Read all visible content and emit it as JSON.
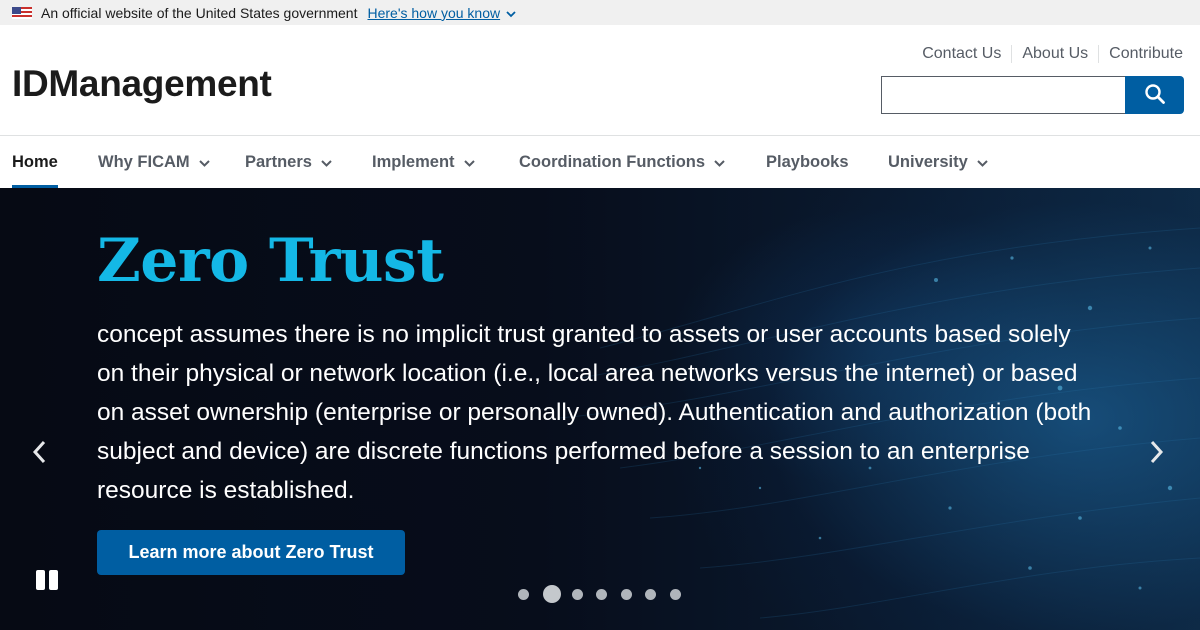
{
  "gov_banner": {
    "text": "An official website of the United States government",
    "link": "Here's how you know"
  },
  "header": {
    "site_title": "IDManagement",
    "secondary_links": [
      "Contact Us",
      "About Us",
      "Contribute"
    ],
    "search": {
      "value": "",
      "placeholder": ""
    }
  },
  "nav": {
    "items": [
      {
        "label": "Home",
        "active": true,
        "has_dropdown": false
      },
      {
        "label": "Why FICAM",
        "has_dropdown": true
      },
      {
        "label": "Partners",
        "has_dropdown": true
      },
      {
        "label": "Implement",
        "has_dropdown": true
      },
      {
        "label": "Coordination Functions",
        "has_dropdown": true
      },
      {
        "label": "Playbooks",
        "has_dropdown": false
      },
      {
        "label": "University",
        "has_dropdown": true
      }
    ]
  },
  "hero": {
    "title": "Zero Trust",
    "description": "concept assumes there is no implicit trust granted to assets or user accounts based solely on their physical or network location (i.e., local area networks versus the internet) or based on asset ownership (enterprise or personally owned). Authentication and authorization (both subject and device) are discrete functions performed before a session to an enterprise resource is established.",
    "cta_label": "Learn more about Zero Trust",
    "slide_count": 7,
    "active_slide": 2
  },
  "icons": {
    "flag": "us-flag-icon",
    "search": "search-icon",
    "dropdown": "chevron-down-icon",
    "prev": "chevron-left-icon",
    "next": "chevron-right-icon",
    "pause": "pause-icon"
  },
  "colors": {
    "primary": "#005ea2",
    "hero_title": "#14b8e6",
    "nav_text": "#565c65",
    "banner_bg": "#f0f0f0"
  }
}
